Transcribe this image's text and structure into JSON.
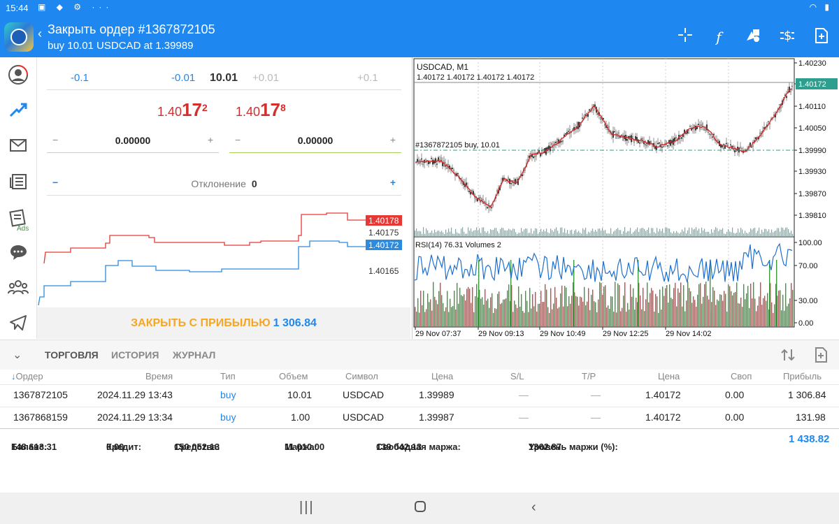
{
  "status": {
    "time": "15:44"
  },
  "appbar": {
    "title": "Закрыть ордер #1367872105",
    "subtitle": "buy 10.01 USDCAD at 1.39989"
  },
  "order_panel": {
    "volume": [
      "-0.1",
      "-0.01",
      "10.01",
      "+0.01",
      "+0.1"
    ],
    "bid": {
      "prefix": "1.40",
      "big": "17",
      "sup": "2"
    },
    "ask": {
      "prefix": "1.40",
      "big": "17",
      "sup": "8"
    },
    "sl_value": "0.00000",
    "tp_value": "0.00000",
    "deviation_label": "Отклонение",
    "deviation_value": "0",
    "mini_chart": {
      "ask_label": "1.40178",
      "mid_label": "1.40175",
      "bid_label": "1.40172",
      "low_label": "1.40165"
    },
    "close_text": "ЗАКРЫТЬ С ПРИБЫЛЬЮ",
    "close_value": "1 306.84"
  },
  "chart": {
    "symbol": "USDCAD, M1",
    "ohlc": "1.40172 1.40172 1.40172 1.40172",
    "order_line": "#1367872105 buy, 10.01",
    "price_ticks": [
      "1.40230",
      "1.40172",
      "1.40110",
      "1.40050",
      "1.39990",
      "1.39930",
      "1.39870",
      "1.39810"
    ],
    "rsi_label": "RSI(14) 76.31 Volumes 2",
    "rsi_ticks": [
      "100.00",
      "70.00",
      "30.00",
      "0.00"
    ],
    "time_ticks": [
      "29 Nov 07:37",
      "29 Nov 09:13",
      "29 Nov 10:49",
      "29 Nov 12:25",
      "29 Nov 14:02"
    ],
    "colors": {
      "ma": "#d32f2f",
      "rsi": "#1e6fd0",
      "current": "#2e9e8e"
    }
  },
  "tabs": [
    "ТОРГОВЛЯ",
    "ИСТОРИЯ",
    "ЖУРНАЛ"
  ],
  "table": {
    "headers": [
      "Ордер",
      "Время",
      "Тип",
      "Объем",
      "Символ",
      "Цена",
      "S/L",
      "T/P",
      "Цена",
      "Своп",
      "Прибыль"
    ],
    "rows": [
      [
        "1367872105",
        "2024.11.29 13:43",
        "buy",
        "10.01",
        "USDCAD",
        "1.39989",
        "—",
        "—",
        "1.40172",
        "0.00",
        "1 306.84"
      ],
      [
        "1367868159",
        "2024.11.29 13:34",
        "buy",
        "1.00",
        "USDCAD",
        "1.39987",
        "—",
        "—",
        "1.40172",
        "0.00",
        "131.98"
      ]
    ]
  },
  "summary": {
    "balance_label": "Баланс:",
    "balance": "148 613.31",
    "credit_label": "Кредит:",
    "credit": "0.00",
    "equity_label": "Средства:",
    "equity": "150 052.13",
    "margin_label": "Маржа:",
    "margin": "11 010.00",
    "free_label": "Свободная маржа:",
    "free": "139 042.13",
    "level_label": "Уровень маржи (%):",
    "level": "1362.87",
    "total": "1 438.82"
  }
}
